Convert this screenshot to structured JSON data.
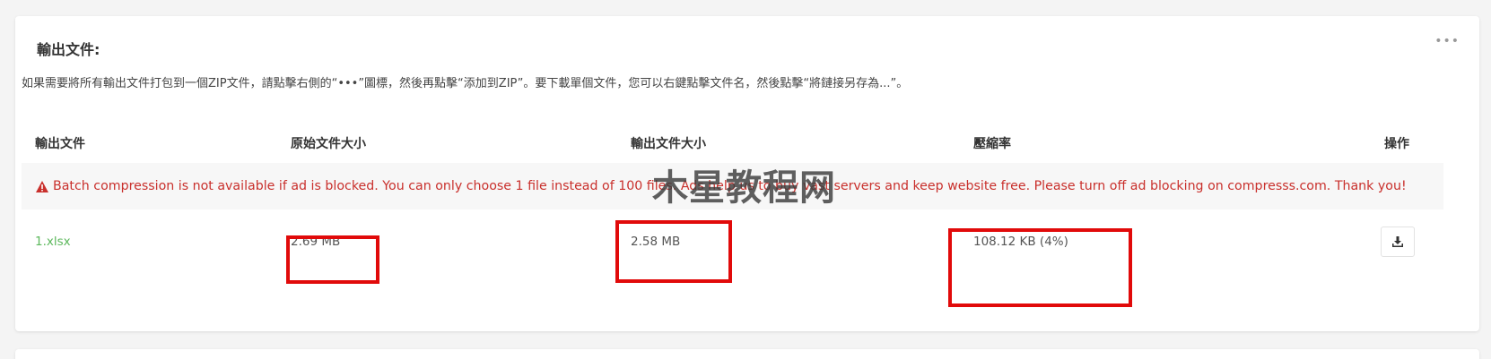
{
  "card": {
    "title": "輸出文件:",
    "more_icon": "•••",
    "instructions": "如果需要將所有輸出文件打包到一個ZIP文件，請點擊右側的“•••”圖標，然後再點擊“添加到ZIP”。要下載單個文件，您可以右鍵點擊文件名，然後點擊“將鏈接另存為...”。"
  },
  "table": {
    "headers": {
      "file": "輸出文件",
      "original_size": "原始文件大小",
      "output_size": "輸出文件大小",
      "ratio": "壓縮率",
      "actions": "操作"
    },
    "alert": {
      "icon": "warning-triangle-icon",
      "text": "Batch compression is not available if ad is blocked. You can only choose 1 file instead of 100 files. Ads help us to buy vast servers and keep website free. Please turn off ad blocking on compresss.com. Thank you!"
    },
    "rows": [
      {
        "file": "1.xlsx",
        "original_size": "2.69 MB",
        "output_size": "2.58 MB",
        "ratio": "108.12 KB (4%)",
        "action_icon": "download-icon"
      }
    ]
  },
  "watermark": "木星教程网",
  "colors": {
    "link_green": "#5cb85c",
    "alert_red": "#c9302c",
    "highlight_red": "#e10a0a",
    "background": "#f4f4f4"
  }
}
